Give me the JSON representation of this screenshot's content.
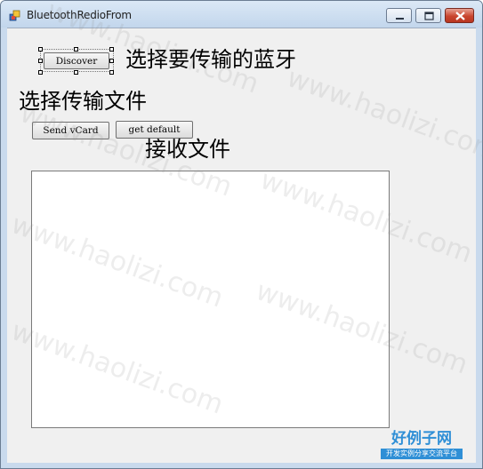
{
  "window": {
    "title": "BluetoothRedioFrom"
  },
  "form": {
    "discover_button": "Discover",
    "label_select_bluetooth": "选择要传输的蓝牙",
    "label_select_file": "选择传输文件",
    "send_vcard_button": "Send vCard",
    "get_default_button": "get default",
    "label_receive_file": "接收文件"
  },
  "watermark": {
    "text": "www.haolizi.com",
    "brand_main": "好例子网",
    "brand_sub": "开发实例分享交流平台"
  },
  "colors": {
    "client_bg": "#f0f0f0",
    "titlebar": "#c9daed",
    "close_button": "#c9452f",
    "brand": "#2f8fd6"
  },
  "icons": [
    "app-icon",
    "minimize-icon",
    "maximize-icon",
    "close-icon"
  ]
}
